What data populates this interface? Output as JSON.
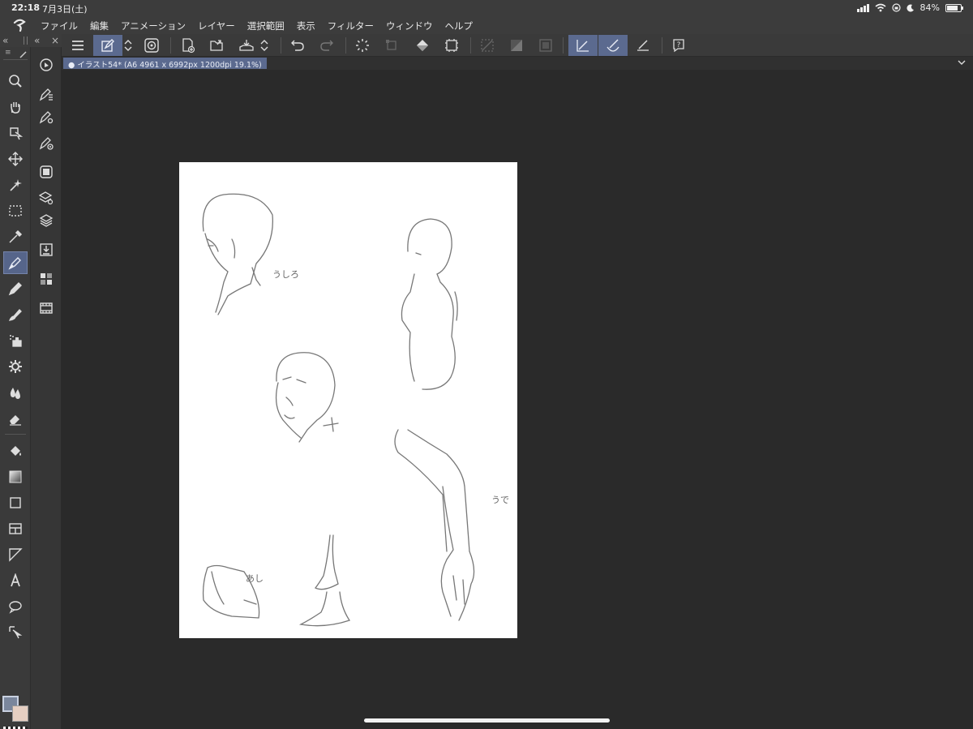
{
  "status_bar": {
    "time": "22:18",
    "date": "7月3日(土)",
    "battery_percent": "84%",
    "battery_level": 0.84
  },
  "menu": {
    "items": [
      "ファイル",
      "編集",
      "アニメーション",
      "レイヤー",
      "選択範囲",
      "表示",
      "フィルター",
      "ウィンドウ",
      "ヘルプ"
    ]
  },
  "tab": {
    "title": "イラスト54* (A6 4961 x 6992px 1200dpi 19.1%)"
  },
  "canvas_labels": {
    "head_side": "うしろ",
    "arm": "うで",
    "foot": "あし"
  },
  "colors": {
    "main_color": "#7a869c",
    "sub_color": "#e6cfc2",
    "accent": "#5b6a8f"
  },
  "icons": {
    "toolbox": [
      "zoom-icon",
      "hand-icon",
      "operation-icon",
      "move-layer-icon",
      "auto-select-icon",
      "selection-icon",
      "eyedropper-icon",
      "pen-icon",
      "pencil-icon",
      "brush-icon",
      "airbrush-icon",
      "decoration-icon",
      "blend-icon",
      "eraser-icon",
      "fill-icon",
      "gradient-icon",
      "figure-icon",
      "frame-border-icon",
      "ruler-icon",
      "text-icon",
      "balloon-icon",
      "correct-line-icon"
    ],
    "subtool": [
      "rotate-icon",
      "pen-subtool-icon",
      "pen-settings-icon",
      "pen-brush-icon",
      "navigator-icon",
      "layer-property-icon",
      "layers-icon",
      "material-icon",
      "color-set-icon",
      "timeline-icon"
    ]
  }
}
